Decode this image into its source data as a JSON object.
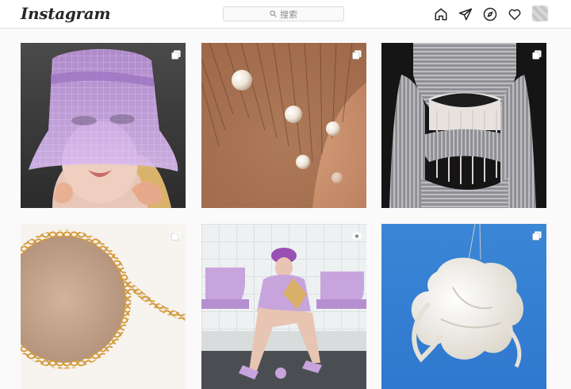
{
  "app": {
    "logo": "Instagram"
  },
  "search": {
    "placeholder": "搜索"
  },
  "nav": {
    "items": [
      "home-icon",
      "direct-icon",
      "explore-icon",
      "activity-icon"
    ]
  },
  "posts": [
    {
      "name": "post-lilac-bucket-hat",
      "badge": "multiple-photos-icon"
    },
    {
      "name": "post-pearl-hair-pins",
      "badge": "multiple-photos-icon"
    },
    {
      "name": "post-striped-knit-corset",
      "badge": "multiple-photos-icon"
    },
    {
      "name": "post-gold-chain-sunglasses",
      "badge": "multiple-photos-icon"
    },
    {
      "name": "post-lilac-outfit-station",
      "badge": "video-icon"
    },
    {
      "name": "post-white-ruffle-sculpture",
      "badge": "multiple-photos-icon"
    }
  ],
  "colors": {
    "border": "#dbdbdb",
    "text": "#262626",
    "muted": "#8e8e8e",
    "lilac": "#c9a5e0"
  }
}
